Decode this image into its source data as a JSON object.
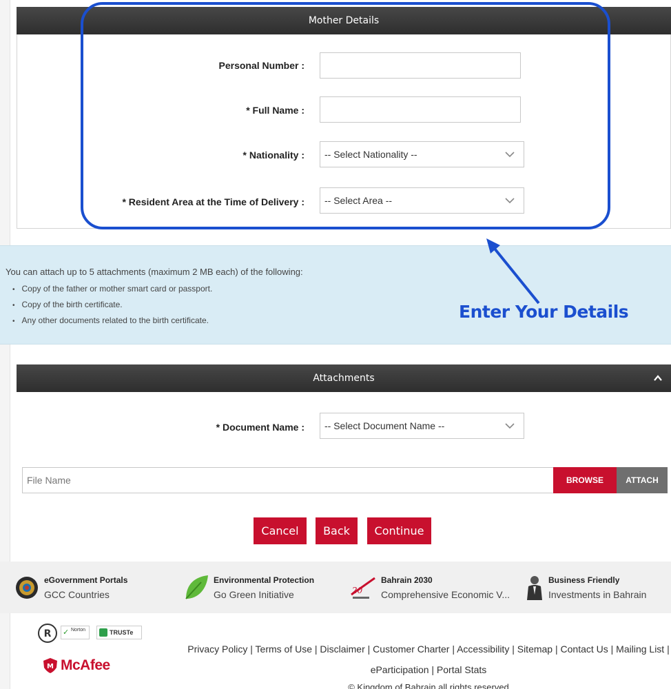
{
  "mother_panel": {
    "title": "Mother Details",
    "fields": {
      "personal_number_label": "Personal Number :",
      "full_name_label": "* Full Name :",
      "nationality_label": "* Nationality :",
      "nationality_value": "-- Select Nationality --",
      "area_label": "* Resident Area at the Time of Delivery :",
      "area_value": "-- Select Area --"
    }
  },
  "info": {
    "intro": "You can attach up to 5 attachments (maximum 2 MB each) of the following:",
    "items": [
      "Copy of the father or mother smart card or passport.",
      "Copy of the birth certificate.",
      "Any other documents related to the birth certificate."
    ]
  },
  "annotation": {
    "text": "Enter Your Details",
    "color": "#1b4fcf"
  },
  "attachments_panel": {
    "title": "Attachments",
    "document_name_label": "* Document Name :",
    "document_name_value": "-- Select Document Name --",
    "file_placeholder": "File Name",
    "browse_label": "BROWSE",
    "attach_label": "ATTACH"
  },
  "actions": {
    "cancel": "Cancel",
    "back": "Back",
    "continue": "Continue"
  },
  "footer": {
    "items": [
      {
        "title": "eGovernment Portals",
        "sub": "GCC Countries",
        "icon": "gcc-emblem-icon"
      },
      {
        "title": "Environmental Protection",
        "sub": "Go Green Initiative",
        "icon": "leaf-icon"
      },
      {
        "title": "Bahrain 2030",
        "sub": "Comprehensive Economic V...",
        "icon": "bahrain-2030-icon"
      },
      {
        "title": "Business Friendly",
        "sub": "Investments in Bahrain",
        "icon": "businessman-icon"
      }
    ],
    "links_line1": "Privacy Policy | Terms of Use | Disclaimer | Customer Charter | Accessibility | Sitemap | Contact Us | Mailing List |",
    "links_line2": "eParticipation | Portal Stats",
    "copyright": "© Kingdom of Bahrain all rights reserved",
    "seals": {
      "norton": "Norton",
      "truste": "TRUSTe",
      "mcafee": "McAfee"
    }
  },
  "colors": {
    "accent_red": "#c8102e",
    "header_dark": "#3a3a3a",
    "info_bg": "#d9ecf5"
  }
}
